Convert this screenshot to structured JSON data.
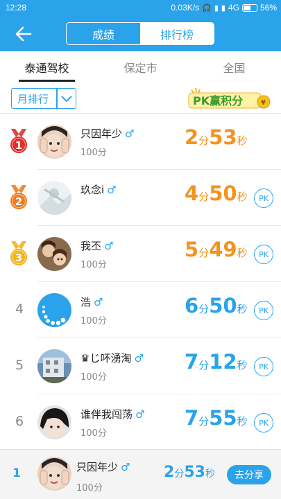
{
  "status": {
    "time": "12:28",
    "net_speed": "0.03K/s",
    "network": "4G",
    "battery": "56%"
  },
  "header": {
    "segment_left": "成绩",
    "segment_right": "排行榜",
    "active_segment": "排行榜"
  },
  "tabs": [
    "泰通驾校",
    "保定市",
    "全国"
  ],
  "filter": {
    "dropdown_value": "月排行",
    "logo_text": "PK赢积分"
  },
  "ranking": [
    {
      "rank": "1",
      "medal": "red",
      "name": "只因年少",
      "score": "100分",
      "min": "2",
      "sec": "53",
      "color": "orange",
      "pk": false,
      "avatar": "avatar-boy-hands"
    },
    {
      "rank": "2",
      "medal": "orange",
      "name": "玖念i",
      "score": "",
      "min": "4",
      "sec": "50",
      "color": "orange",
      "pk": true,
      "avatar": "avatar-white-photo"
    },
    {
      "rank": "3",
      "medal": "gold",
      "name": "我丕",
      "score": "100分",
      "min": "5",
      "sec": "49",
      "color": "orange",
      "pk": true,
      "avatar": "avatar-two-girls"
    },
    {
      "rank": "4",
      "medal": "",
      "name": "浩",
      "score": "100分",
      "min": "6",
      "sec": "50",
      "color": "blue",
      "pk": true,
      "avatar": "avatar-loading-dots"
    },
    {
      "rank": "5",
      "medal": "",
      "name": "♛じ吥湧淘",
      "score": "100分",
      "min": "7",
      "sec": "12",
      "color": "blue",
      "pk": true,
      "avatar": "avatar-building"
    },
    {
      "rank": "6",
      "medal": "",
      "name": "谁伴我闯荡",
      "score": "100分",
      "min": "7",
      "sec": "55",
      "color": "blue",
      "pk": true,
      "avatar": "avatar-dark-hair"
    }
  ],
  "units": {
    "min": "分",
    "sec": "秒",
    "male": "♂",
    "pk": "PK"
  },
  "my_rank": {
    "rank": "1",
    "name": "只因年少",
    "score": "100分",
    "min": "2",
    "sec": "53",
    "share_label": "去分享"
  },
  "colors": {
    "primary": "#2aa3ea",
    "accent_orange": "#f39320",
    "medal_red": "#e0302c",
    "medal_orange": "#f07c1f",
    "medal_gold": "#f4b21b"
  }
}
